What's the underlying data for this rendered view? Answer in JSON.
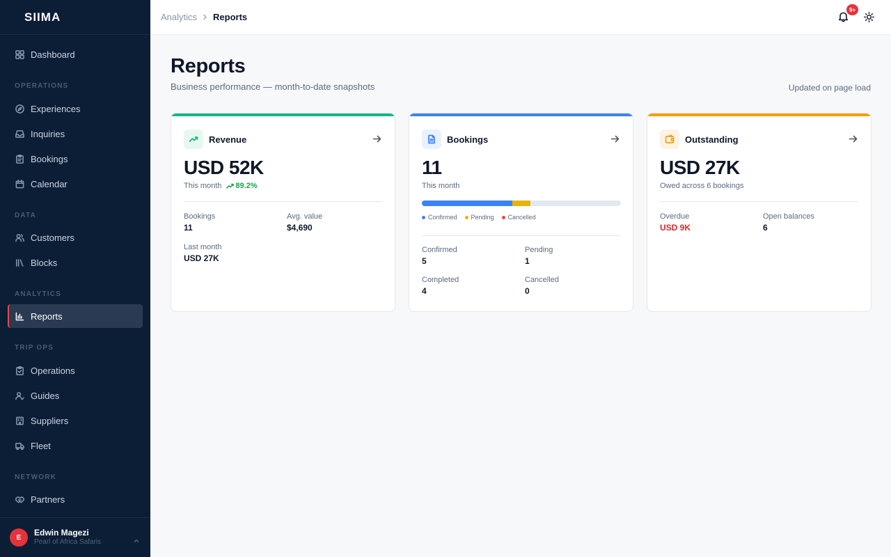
{
  "app": {
    "brand": "SIIMA"
  },
  "sidebar": {
    "top_items": [
      {
        "label": "Dashboard",
        "icon": "grid-icon"
      }
    ],
    "sections": [
      {
        "label": "OPERATIONS",
        "items": [
          {
            "label": "Experiences",
            "icon": "compass-icon"
          },
          {
            "label": "Inquiries",
            "icon": "inbox-icon"
          },
          {
            "label": "Bookings",
            "icon": "clipboard-icon"
          },
          {
            "label": "Calendar",
            "icon": "calendar-icon"
          }
        ]
      },
      {
        "label": "DATA",
        "items": [
          {
            "label": "Customers",
            "icon": "users-icon"
          },
          {
            "label": "Blocks",
            "icon": "library-icon"
          }
        ]
      },
      {
        "label": "ANALYTICS",
        "items": [
          {
            "label": "Reports",
            "icon": "bar-chart-icon",
            "active": true
          }
        ]
      },
      {
        "label": "TRIP OPS",
        "items": [
          {
            "label": "Operations",
            "icon": "clipboard-check-icon"
          },
          {
            "label": "Guides",
            "icon": "user-check-icon"
          },
          {
            "label": "Suppliers",
            "icon": "building-icon"
          },
          {
            "label": "Fleet",
            "icon": "truck-icon"
          }
        ]
      },
      {
        "label": "NETWORK",
        "items": [
          {
            "label": "Partners",
            "icon": "handshake-icon"
          }
        ]
      }
    ],
    "user": {
      "initial": "E",
      "name": "Edwin Magezi",
      "org": "Pearl of Africa Safaris"
    }
  },
  "topbar": {
    "breadcrumb_parent": "Analytics",
    "breadcrumb_current": "Reports",
    "notification_badge": "9+"
  },
  "page": {
    "title": "Reports",
    "subtitle": "Business performance — month-to-date snapshots",
    "updated_note": "Updated on page load"
  },
  "cards": {
    "revenue": {
      "title": "Revenue",
      "accent": "#10b981",
      "value": "USD 52K",
      "period": "This month",
      "trend": "89.2%",
      "stats": [
        {
          "label": "Bookings",
          "value": "11"
        },
        {
          "label": "Avg. value",
          "value": "$4,690"
        },
        {
          "label": "Last month",
          "value": "USD 27K"
        }
      ]
    },
    "bookings": {
      "title": "Bookings",
      "accent": "#3b82f6",
      "value": "11",
      "period": "This month",
      "status_bar": {
        "total": 11,
        "confirmed": 5,
        "pending": 1,
        "cancelled": 0
      },
      "legend": [
        {
          "label": "Confirmed",
          "color": "#3b82f6"
        },
        {
          "label": "Pending",
          "color": "#eab308"
        },
        {
          "label": "Cancelled",
          "color": "#ef4444"
        }
      ],
      "stats": [
        {
          "label": "Confirmed",
          "value": "5"
        },
        {
          "label": "Pending",
          "value": "1"
        },
        {
          "label": "Completed",
          "value": "4"
        },
        {
          "label": "Cancelled",
          "value": "0"
        }
      ]
    },
    "outstanding": {
      "title": "Outstanding",
      "accent": "#f59e0b",
      "value": "USD 27K",
      "period": "Owed across 6 bookings",
      "stats": [
        {
          "label": "Overdue",
          "value": "USD 9K"
        },
        {
          "label": "Open balances",
          "value": "6"
        }
      ]
    }
  }
}
